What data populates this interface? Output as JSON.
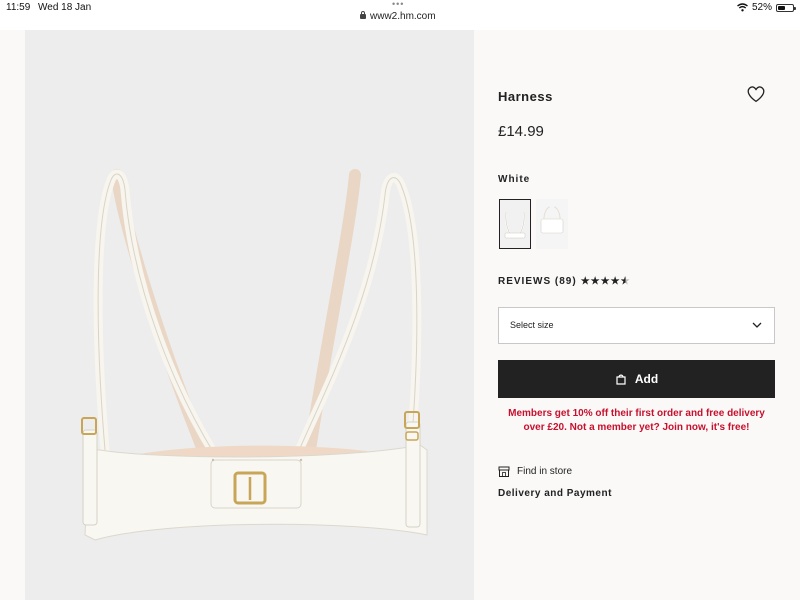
{
  "status_bar": {
    "time": "11:59",
    "date": "Wed 18 Jan",
    "url": "www2.hm.com",
    "battery": "52%",
    "battery_level": 0.52
  },
  "product": {
    "title": "Harness",
    "price": "£14.99",
    "color_name": "White",
    "swatches": [
      {
        "name": "White",
        "selected": true
      },
      {
        "name": "White variant",
        "selected": false
      }
    ],
    "reviews_label": "REVIEWS (89)",
    "rating": 4.5,
    "rating_max": 5
  },
  "size_select": {
    "label": "Select size"
  },
  "add_button": {
    "label": "Add"
  },
  "member_message": "Members get 10% off their first order and free delivery over £20. Not a member yet? Join now, it's free!",
  "find_in_store": "Find in store",
  "delivery_payment": "Delivery and Payment",
  "colors": {
    "accent_red": "#c8102e",
    "button_dark": "#222222",
    "image_bg": "#ededed",
    "panel_bg": "#faf9f8"
  },
  "icons": [
    "lock-icon",
    "wifi-icon",
    "battery-icon",
    "heart-icon",
    "chevron-down-icon",
    "bag-icon",
    "store-icon",
    "star-icon"
  ]
}
